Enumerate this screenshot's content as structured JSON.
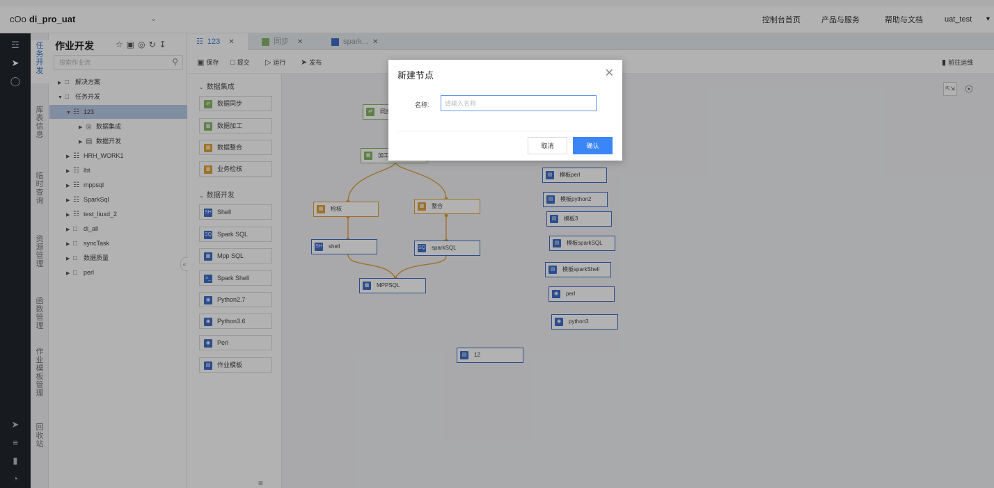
{
  "header": {
    "brand_logo": "cOo",
    "brand_name": "di_pro_uat",
    "nav": [
      "控制台首页",
      "产品与服务",
      "帮助与文档"
    ],
    "user": "uat_test"
  },
  "vertical_tabs": [
    "任务开发",
    "库表信息",
    "临时查询",
    "资源管理",
    "函数管理",
    "作业模板管理",
    "回收站"
  ],
  "tree": {
    "title": "作业开发",
    "search_placeholder": "搜索作业流",
    "rows": [
      {
        "label": "解决方案",
        "type": "folder",
        "expanded": false
      },
      {
        "label": "任务开发",
        "type": "folder",
        "expanded": true
      },
      {
        "label": "123",
        "type": "flow",
        "expanded": true,
        "selected": true
      },
      {
        "label": "数据集成",
        "type": "integration",
        "expanded": false
      },
      {
        "label": "数据开发",
        "type": "dev",
        "expanded": false
      },
      {
        "label": "HRH_WORK1",
        "type": "flow",
        "expanded": false
      },
      {
        "label": "lbt",
        "type": "flow",
        "expanded": false
      },
      {
        "label": "mppsql",
        "type": "flow",
        "expanded": false
      },
      {
        "label": "SparkSql",
        "type": "flow",
        "expanded": false
      },
      {
        "label": "test_liuxd_2",
        "type": "flow",
        "expanded": false
      },
      {
        "label": "di_all",
        "type": "folder",
        "expanded": false
      },
      {
        "label": "syncTask",
        "type": "folder",
        "expanded": false
      },
      {
        "label": "数据质量",
        "type": "folder",
        "expanded": false
      },
      {
        "label": "perl",
        "type": "folder",
        "expanded": false
      }
    ]
  },
  "tabs": [
    {
      "label": "123",
      "active": true
    },
    {
      "label": "同步",
      "active": false
    },
    {
      "label": "spark...",
      "active": false
    }
  ],
  "toolbar": {
    "save": "保存",
    "submit": "提交",
    "run": "运行",
    "publish": "发布",
    "go_prod": "前往运维"
  },
  "palette": {
    "group1": "数据集成",
    "group1_items": [
      "数据同步",
      "数据加工",
      "数据整合",
      "业务检核"
    ],
    "group2": "数据开发",
    "group2_items": [
      "Shell",
      "Spark SQL",
      "Mpp SQL",
      "Spark Shell",
      "Python2.7",
      "Python3.6",
      "Perl",
      "作业模板"
    ]
  },
  "canvas": {
    "nodes": [
      "同步",
      "加工",
      "检核",
      "整合",
      "shell",
      "sparkSQL",
      "MPPSQL",
      "模板perl",
      "模板python2",
      "模板3",
      "模板sparkSQL",
      "模板sparkShell",
      "perl",
      "python3",
      "12"
    ]
  },
  "modal": {
    "title": "新建节点",
    "name_label": "名称:",
    "name_placeholder": "请输入名称",
    "cancel": "取消",
    "confirm": "确认"
  },
  "colors": {
    "accent": "#3b86f7",
    "rail": "#22262d",
    "edge": "#e3a23a",
    "green_node": "#86b866",
    "blue_node": "#3f6ecb"
  }
}
